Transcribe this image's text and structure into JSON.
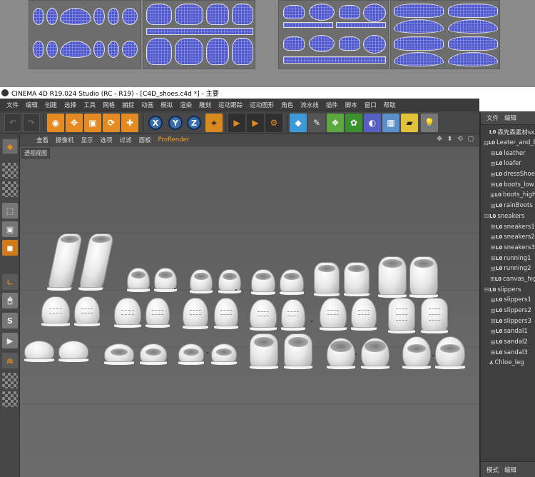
{
  "window": {
    "title": "CINEMA 4D R19.024 Studio (RC - R19) - [C4D_shoes.c4d *] - 主要"
  },
  "menubar": {
    "items": [
      "文件",
      "编辑",
      "创建",
      "选择",
      "工具",
      "网格",
      "捕捉",
      "动画",
      "模拟",
      "渲染",
      "雕刻",
      "运动跟踪",
      "运动图形",
      "角色",
      "流水线",
      "插件",
      "脚本",
      "窗口",
      "帮助"
    ]
  },
  "toolbar": {
    "axis_x": "X",
    "axis_y": "Y",
    "axis_z": "Z"
  },
  "viewport_menu": {
    "items": [
      "查看",
      "摄像机",
      "显示",
      "选项",
      "过滤",
      "面板"
    ],
    "renderer": "ProRender",
    "nav_icons": "✥ ⬍ ⟲ ▢"
  },
  "viewport": {
    "label": "透视视图"
  },
  "object_manager": {
    "menu": [
      "文件",
      "编辑"
    ],
    "footer_menu": [
      "模式",
      "编辑"
    ],
    "rows": [
      {
        "name": "森先森素材sx",
        "depth": 0,
        "expand": ""
      },
      {
        "name": "Leater_and_b",
        "depth": 0,
        "expand": "⊟"
      },
      {
        "name": "leather",
        "depth": 1,
        "expand": "⊞"
      },
      {
        "name": "loafer",
        "depth": 1,
        "expand": "⊞"
      },
      {
        "name": "dressShoe",
        "depth": 1,
        "expand": "⊞"
      },
      {
        "name": "boots_low",
        "depth": 1,
        "expand": "⊞"
      },
      {
        "name": "boots_high",
        "depth": 1,
        "expand": "⊞"
      },
      {
        "name": "rainBoots",
        "depth": 1,
        "expand": "⊞"
      },
      {
        "name": "sneakers",
        "depth": 0,
        "expand": "⊟"
      },
      {
        "name": "sneakers1",
        "depth": 1,
        "expand": "⊞"
      },
      {
        "name": "sneakers2",
        "depth": 1,
        "expand": "⊞"
      },
      {
        "name": "sneakers3",
        "depth": 1,
        "expand": "⊞"
      },
      {
        "name": "running1",
        "depth": 1,
        "expand": "⊞"
      },
      {
        "name": "running2",
        "depth": 1,
        "expand": "⊞"
      },
      {
        "name": "canvas_hig",
        "depth": 1,
        "expand": "⊞"
      },
      {
        "name": "slippers",
        "depth": 0,
        "expand": "⊟"
      },
      {
        "name": "slippers1",
        "depth": 1,
        "expand": "⊞"
      },
      {
        "name": "slippers2",
        "depth": 1,
        "expand": "⊞"
      },
      {
        "name": "slippers3",
        "depth": 1,
        "expand": "⊞"
      },
      {
        "name": "sandal1",
        "depth": 1,
        "expand": "⊞"
      },
      {
        "name": "sandal2",
        "depth": 1,
        "expand": "⊞"
      },
      {
        "name": "sandal3",
        "depth": 1,
        "expand": "⊞"
      },
      {
        "name": "Chloe_leg",
        "depth": 0,
        "expand": ""
      }
    ]
  },
  "colors": {
    "accent_orange": "#e38a22",
    "panel_bg": "#3f3f3f",
    "viewport_bg": "#5e5e5e"
  }
}
